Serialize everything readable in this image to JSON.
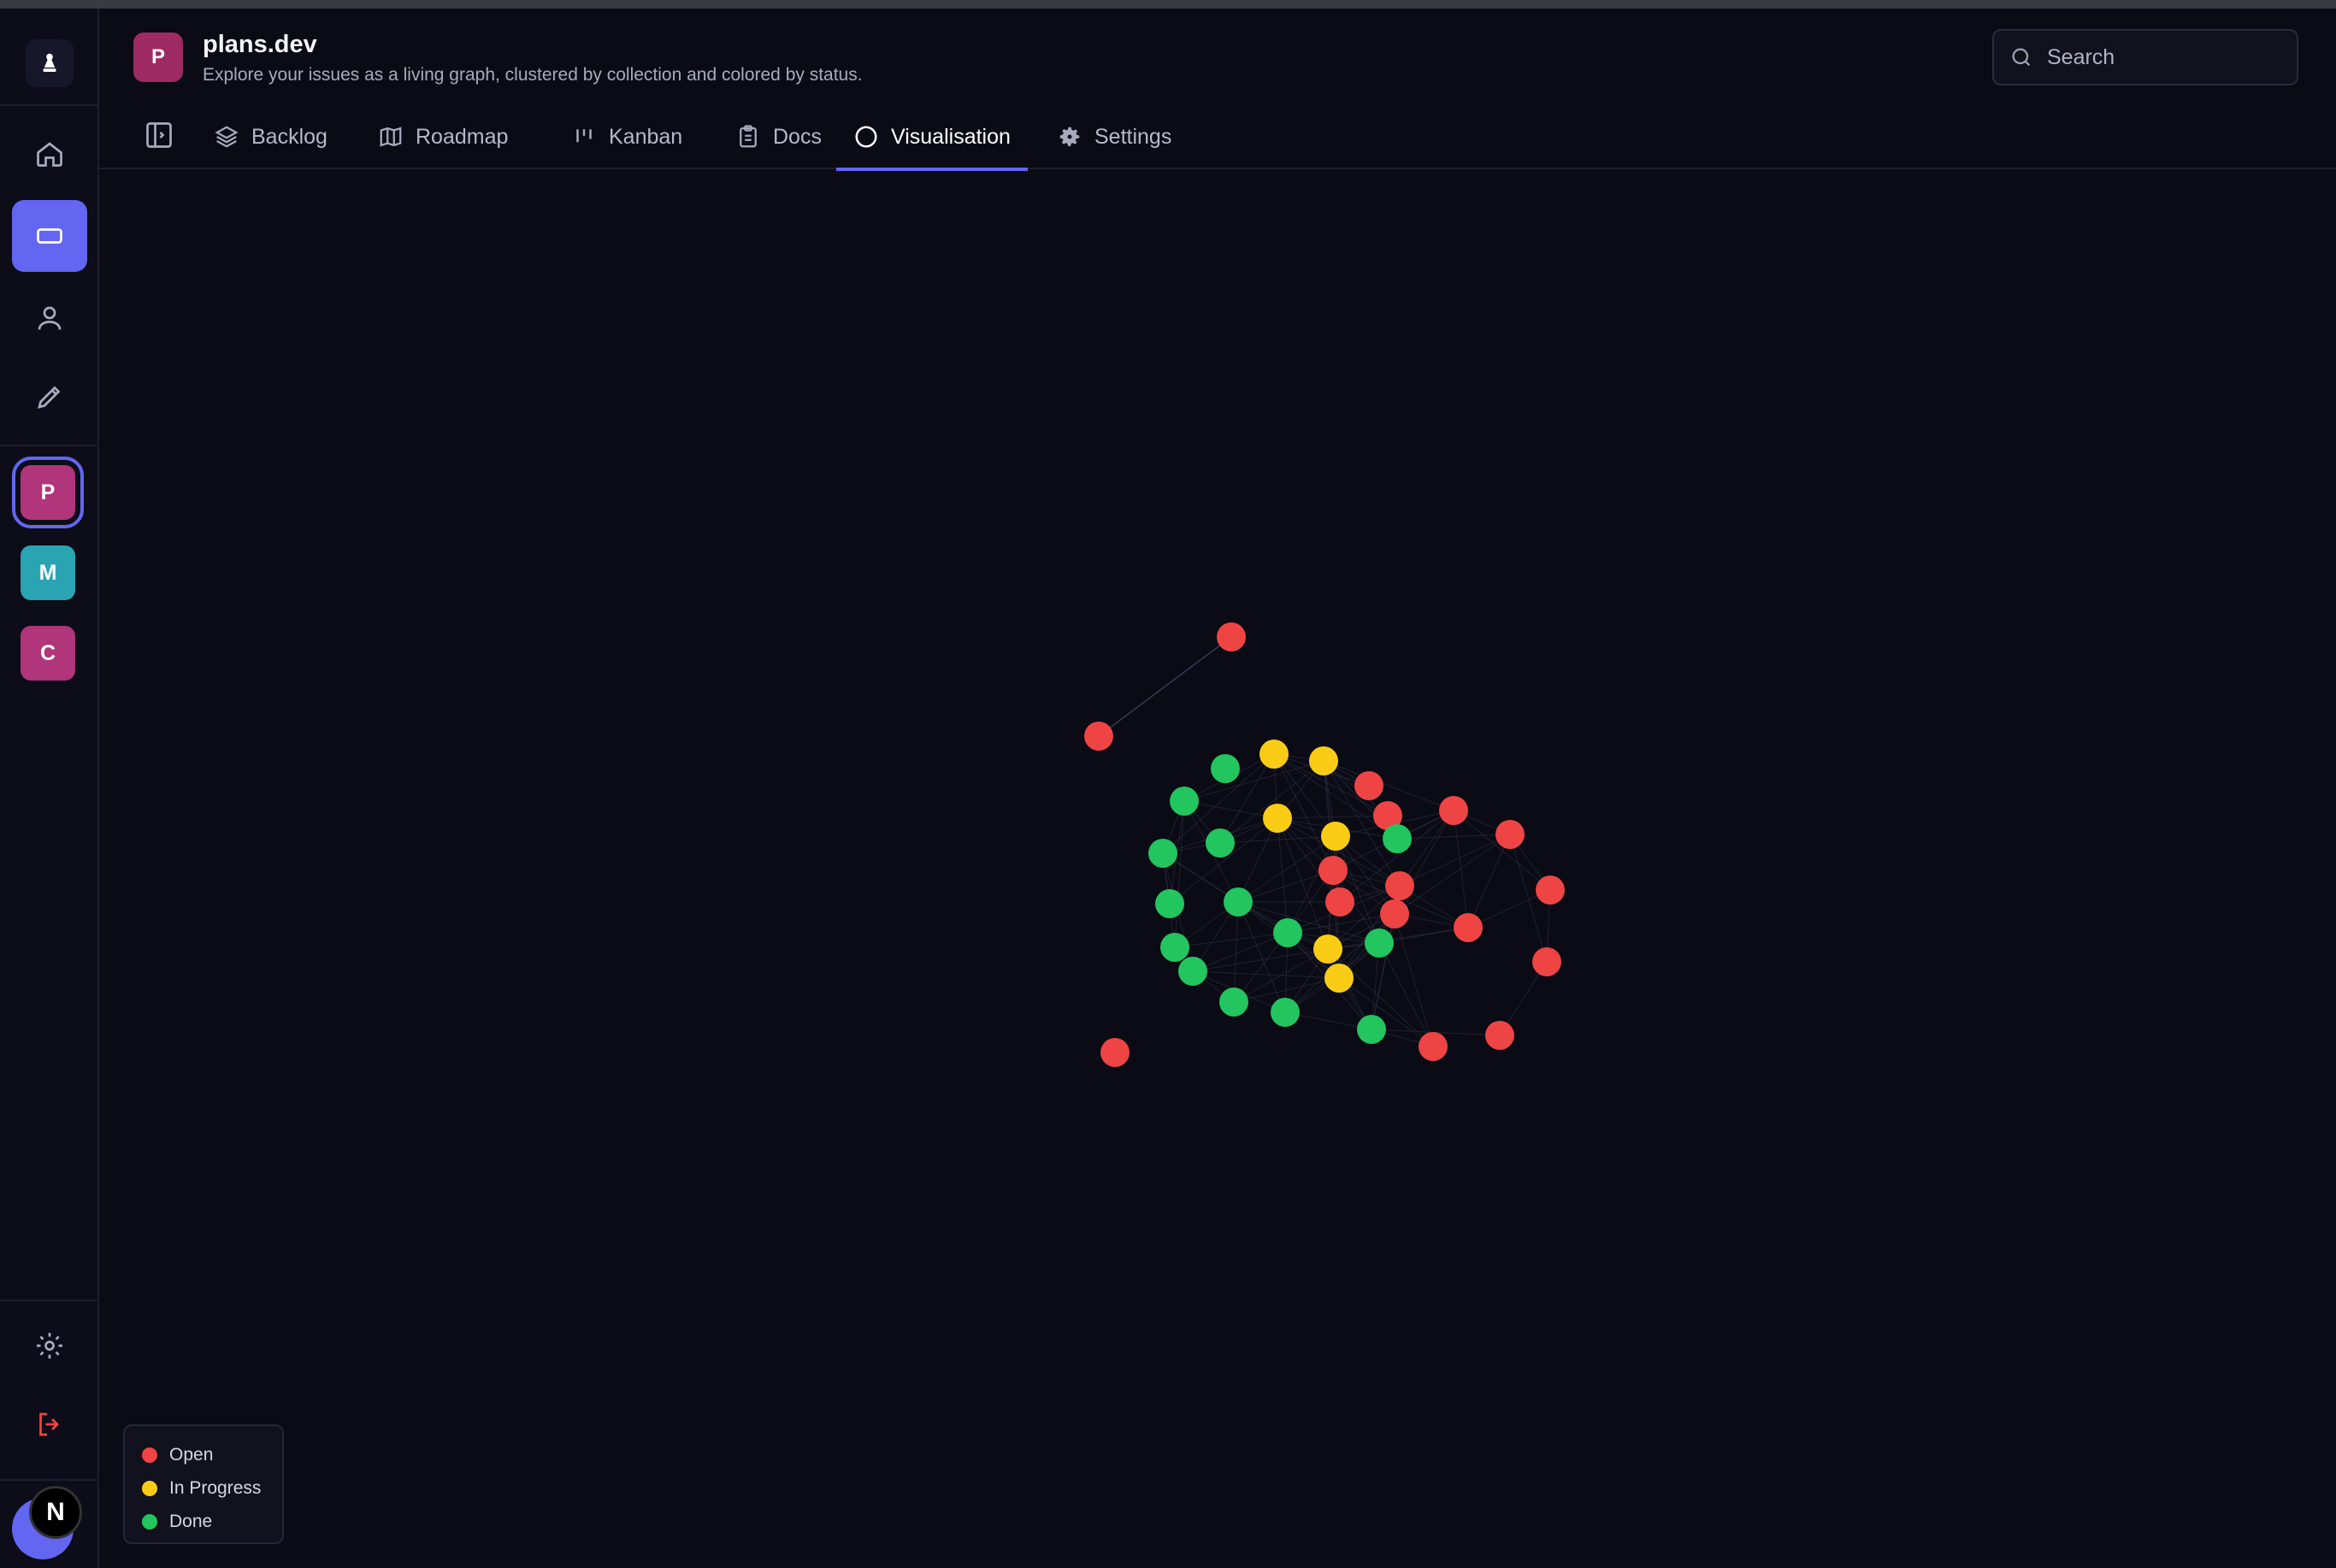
{
  "header": {
    "avatar_letter": "P",
    "title": "plans.dev",
    "subtitle": "Explore your issues as a living graph, clustered by collection and colored by status."
  },
  "search": {
    "placeholder": "Search"
  },
  "tabs": [
    {
      "label": "Backlog",
      "icon": "layers-icon"
    },
    {
      "label": "Roadmap",
      "icon": "map-icon"
    },
    {
      "label": "Kanban",
      "icon": "kanban-icon"
    },
    {
      "label": "Docs",
      "icon": "clipboard-icon"
    },
    {
      "label": "Visualisation",
      "icon": "circle-icon",
      "active": true
    },
    {
      "label": "Settings",
      "icon": "gear-icon"
    }
  ],
  "rail": {
    "nav": [
      "home-icon",
      "projects-icon",
      "user-icon",
      "pencil-icon"
    ],
    "projects": [
      {
        "letter": "P",
        "color": "#b0357a",
        "selected": true
      },
      {
        "letter": "M",
        "color": "#2aa3b3"
      },
      {
        "letter": "C",
        "color": "#b0357a"
      }
    ],
    "user_initial": "N"
  },
  "legend": [
    {
      "label": "Open",
      "color": "#ef4444"
    },
    {
      "label": "In Progress",
      "color": "#facc15"
    },
    {
      "label": "Done",
      "color": "#22c55e"
    }
  ],
  "colors": {
    "accent": "#6366f1",
    "background": "#0a0b14",
    "open": "#ef4444",
    "in_progress": "#facc15",
    "done": "#22c55e",
    "edge": "#3a3c55"
  },
  "graph_nodes": [
    {
      "id": "n1",
      "status": "open"
    },
    {
      "id": "n2",
      "status": "open"
    },
    {
      "id": "n3",
      "status": "open"
    },
    {
      "id": "n4",
      "status": "done"
    },
    {
      "id": "n5",
      "status": "progress"
    },
    {
      "id": "n6",
      "status": "progress"
    },
    {
      "id": "n7",
      "status": "open"
    },
    {
      "id": "n8",
      "status": "done"
    },
    {
      "id": "n9",
      "status": "progress"
    },
    {
      "id": "n10",
      "status": "open"
    },
    {
      "id": "n11",
      "status": "open"
    },
    {
      "id": "n12",
      "status": "open"
    },
    {
      "id": "n13",
      "status": "done"
    },
    {
      "id": "n14",
      "status": "done"
    },
    {
      "id": "n15",
      "status": "progress"
    },
    {
      "id": "n16",
      "status": "done"
    },
    {
      "id": "n17",
      "status": "open"
    },
    {
      "id": "n18",
      "status": "open"
    },
    {
      "id": "n19",
      "status": "done"
    },
    {
      "id": "n20",
      "status": "done"
    },
    {
      "id": "n21",
      "status": "open"
    },
    {
      "id": "n22",
      "status": "open"
    },
    {
      "id": "n23",
      "status": "open"
    },
    {
      "id": "n24",
      "status": "done"
    },
    {
      "id": "n25",
      "status": "done"
    },
    {
      "id": "n26",
      "status": "progress"
    },
    {
      "id": "n27",
      "status": "done"
    },
    {
      "id": "n28",
      "status": "open"
    },
    {
      "id": "n29",
      "status": "done"
    },
    {
      "id": "n30",
      "status": "progress"
    },
    {
      "id": "n31",
      "status": "done"
    },
    {
      "id": "n32",
      "status": "done"
    },
    {
      "id": "n33",
      "status": "done"
    },
    {
      "id": "n34",
      "status": "open"
    },
    {
      "id": "n35",
      "status": "open"
    },
    {
      "id": "n36",
      "status": "open"
    }
  ]
}
